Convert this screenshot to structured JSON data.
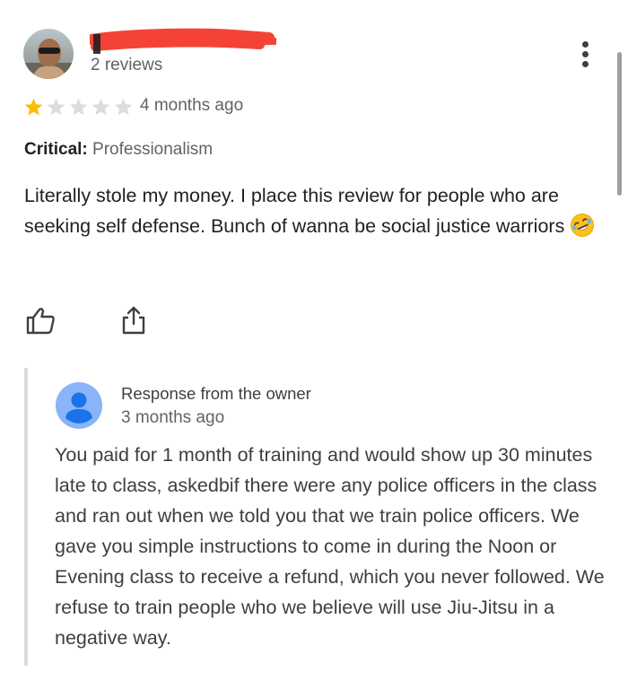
{
  "reviewer": {
    "review_count": "2 reviews",
    "avatar": "reviewer-avatar-photo"
  },
  "menu": {
    "icon": "more-vert-icon"
  },
  "rating": {
    "stars": 1,
    "max_stars": 5,
    "filled_color": "#fbbc04",
    "empty_color": "#dadce0",
    "time_ago": "4 months ago"
  },
  "critical": {
    "label": "Critical:",
    "value": "Professionalism"
  },
  "review": {
    "text": "Literally stole my money. I place this review for people who are seeking self defense. Bunch of wanna be social justice warriors",
    "emoji": "rolling-on-floor-laughing-emoji"
  },
  "actions": {
    "like_icon": "thumb-up-icon",
    "share_icon": "share-icon"
  },
  "owner_response": {
    "title": "Response from the owner",
    "time_ago": "3 months ago",
    "avatar_color": "#8ab4f8",
    "text": "You paid for 1 month of training and would show up 30 minutes late to class, askedbif there were any police officers in the class and ran out when we told you that we train police officers. We gave you simple instructions to come in during the Noon or Evening class to receive a refund, which you never followed. We refuse to train people who we believe will use Jiu-Jitsu in a negative way."
  },
  "colors": {
    "redaction": "#f44336",
    "text_primary": "#202124",
    "text_secondary": "#5f6368"
  }
}
